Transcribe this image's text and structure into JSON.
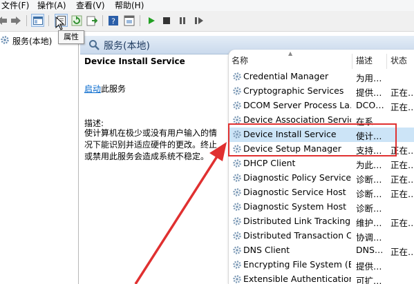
{
  "menu": {
    "file": "文件(F)",
    "action": "操作(A)",
    "view": "查看(V)",
    "help": "帮助(H)"
  },
  "toolbar": {
    "icons": [
      "back-icon",
      "forward-icon",
      "show-tree-icon",
      "properties-icon",
      "refresh-icon",
      "export-icon",
      "help-icon",
      "console-icon",
      "start-icon",
      "stop-icon",
      "pause-icon",
      "restart-icon"
    ]
  },
  "tooltip": {
    "label": "属性"
  },
  "tree": {
    "root_label": "服务(本地)"
  },
  "main": {
    "title": "服务(本地)"
  },
  "details": {
    "service_title": "Device Install Service",
    "start_link": "启动",
    "start_suffix": "此服务",
    "desc_label": "描述:",
    "desc_text": "使计算机在极少或没有用户输入的情况下能识别并适应硬件的更改。终止或禁用此服务会造成系统不稳定。"
  },
  "list": {
    "columns": {
      "name": "名称",
      "description": "描述",
      "status": "状态"
    },
    "rows": [
      {
        "name": "Credential Manager",
        "description": "为用…",
        "status": ""
      },
      {
        "name": "Cryptographic Services",
        "description": "提供…",
        "status": "正在…"
      },
      {
        "name": "DCOM Server Process La…",
        "description": "DCO…",
        "status": "正在…"
      },
      {
        "name": "Device Association Service",
        "description": "在系…",
        "status": ""
      },
      {
        "name": "Device Install Service",
        "description": "使计…",
        "status": ""
      },
      {
        "name": "Device Setup Manager",
        "description": "支持…",
        "status": "正在…"
      },
      {
        "name": "DHCP Client",
        "description": "为此…",
        "status": "正在…"
      },
      {
        "name": "Diagnostic Policy Service",
        "description": "诊断…",
        "status": "正在…"
      },
      {
        "name": "Diagnostic Service Host",
        "description": "诊断…",
        "status": "正在…"
      },
      {
        "name": "Diagnostic System Host",
        "description": "诊断…",
        "status": ""
      },
      {
        "name": "Distributed Link Tracking…",
        "description": "维护…",
        "status": "正在…"
      },
      {
        "name": "Distributed Transaction C…",
        "description": "协调…",
        "status": ""
      },
      {
        "name": "DNS Client",
        "description": "DNS…",
        "status": "正在…"
      },
      {
        "name": "Encrypting File System (E…",
        "description": "提供…",
        "status": ""
      },
      {
        "name": "Extensible Authentication…",
        "description": "可扩…",
        "status": ""
      }
    ],
    "selected_index": 4
  },
  "colors": {
    "highlight": "#e03030",
    "selection": "#cce4f7",
    "link": "#0066cc"
  }
}
